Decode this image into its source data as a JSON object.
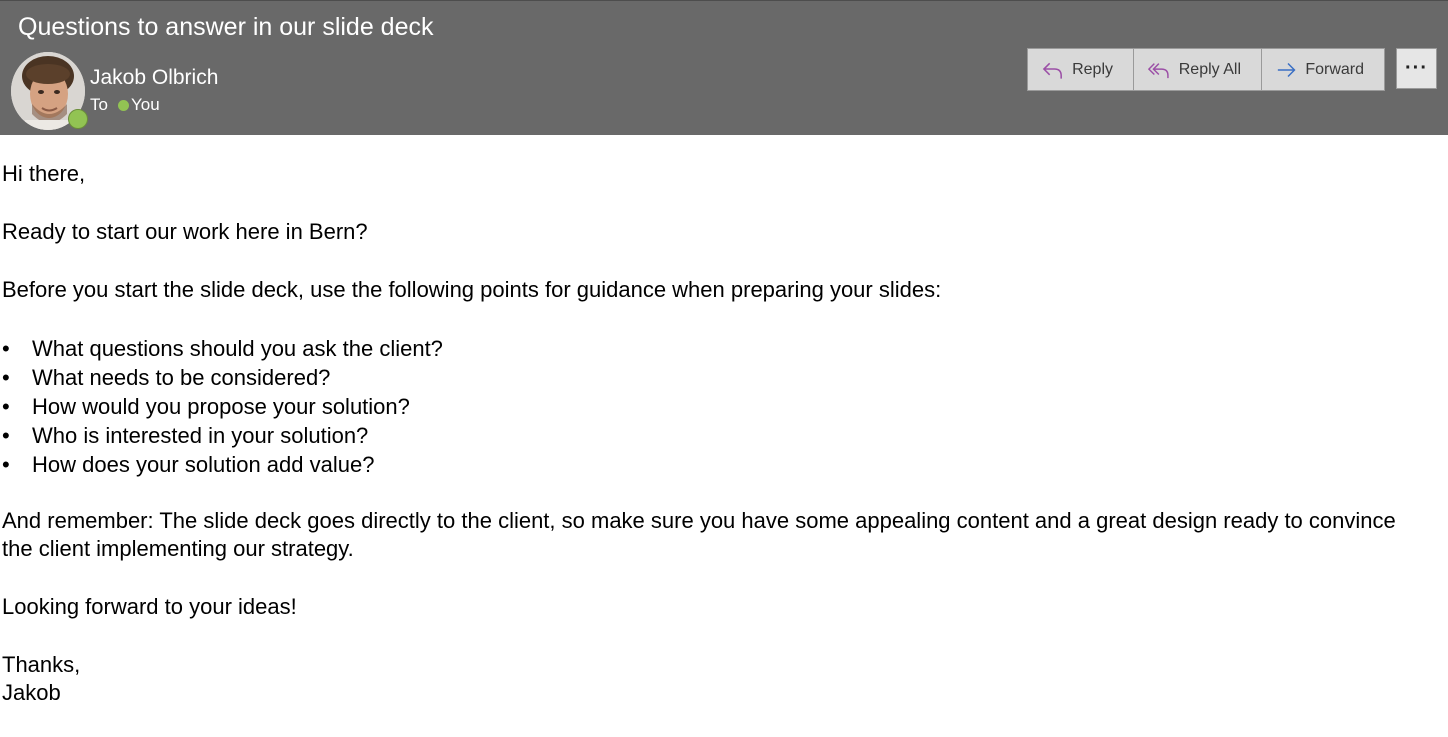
{
  "header": {
    "subject": "Questions to answer in our slide deck",
    "sender_name": "Jakob Olbrich",
    "to_label": "To",
    "recipient": "You",
    "presence_color": "#92c353",
    "avatar_icon": "person-photo-icon"
  },
  "actions": {
    "reply_label": "Reply",
    "reply_all_label": "Reply All",
    "forward_label": "Forward",
    "more_label": "···"
  },
  "message": {
    "greeting": "Hi there,",
    "intro": "Ready to start our work here in Bern?",
    "guidance": "Before you start the slide deck, use the following points for guidance when preparing your slides:",
    "bullets": [
      "What questions should you ask the client?",
      "What needs to be considered?",
      "How would you propose your solution?",
      "Who is interested in your solution?",
      "How does your solution add value?"
    ],
    "reminder": "And remember: The slide deck goes directly to the client, so make sure you have some appealing content and a great design ready to convince the client implementing our strategy.",
    "closing_line": "Looking forward to your ideas!",
    "signoff": "Thanks,",
    "signature": "Jakob"
  }
}
